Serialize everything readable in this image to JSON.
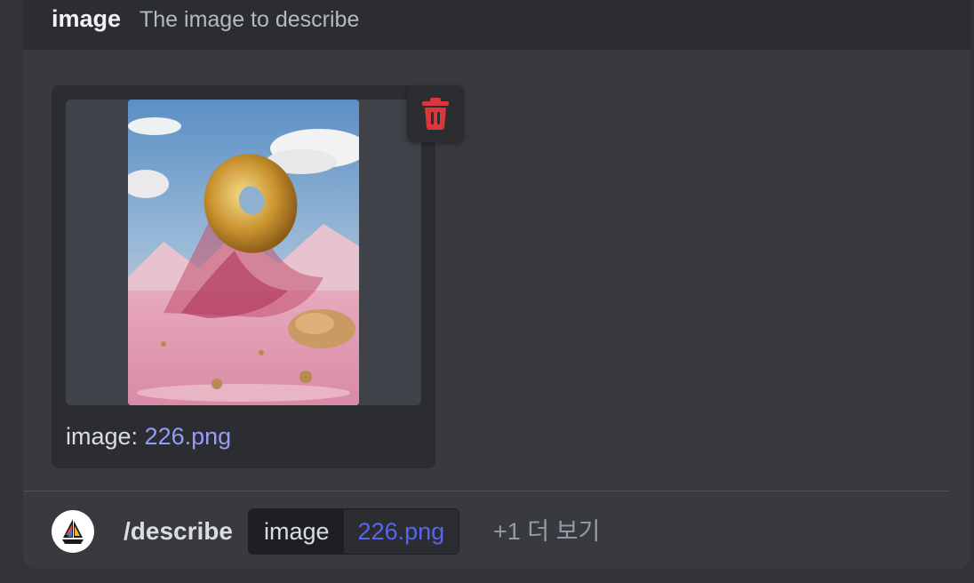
{
  "option_header": {
    "name": "image",
    "description": "The image to describe"
  },
  "attachment": {
    "label": "image: ",
    "filename": "226.png",
    "icons": {
      "delete": "trash-icon"
    },
    "colors": {
      "delete_icon": "#da373c",
      "filename_link": "#949cf7"
    }
  },
  "command_bar": {
    "avatar_icon": "sailboat-logo-icon",
    "command": "/describe",
    "option_key": "image",
    "option_value": "226.png",
    "more_label": "+1 더 보기"
  },
  "colors": {
    "background": "#313338",
    "panel": "#383a40",
    "header": "#2b2d31",
    "accent": "#5865f2"
  }
}
